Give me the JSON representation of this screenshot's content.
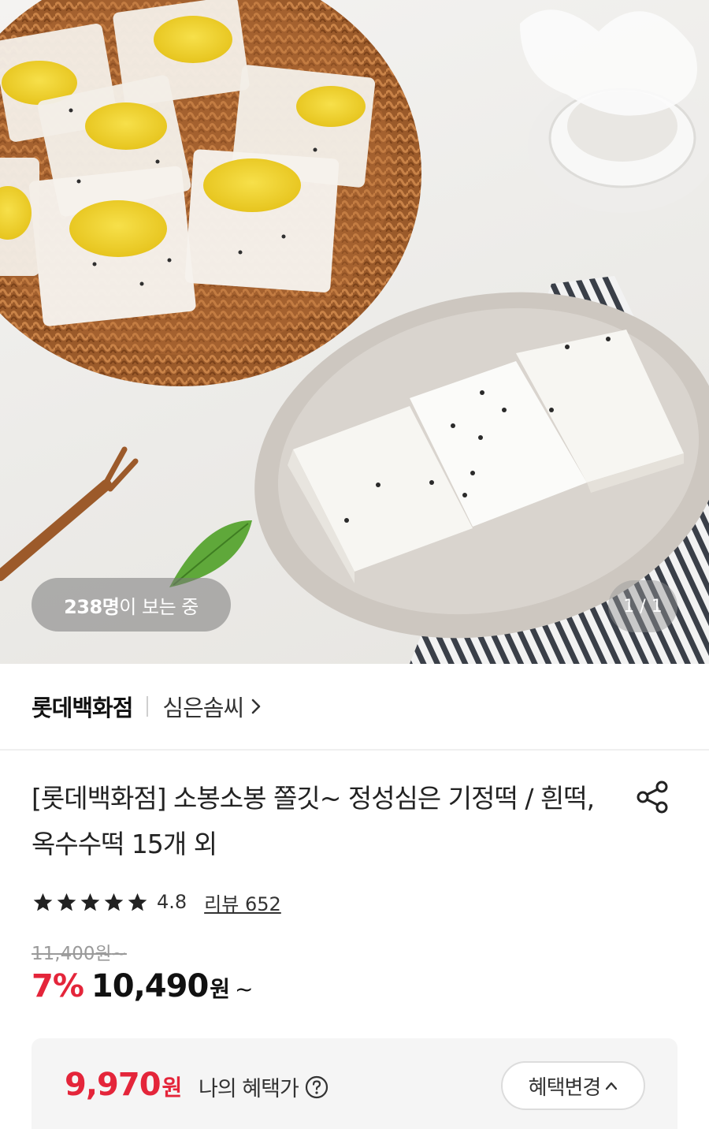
{
  "hero": {
    "viewers_count": "238명",
    "viewers_suffix": "이 보는 중",
    "page_indicator": "1 / 1"
  },
  "seller": {
    "store_name": "롯데백화점",
    "brand_name": "심은솜씨"
  },
  "product": {
    "title": "[롯데백화점] 소봉소봉 쫄깃~ 정성심은 기정떡 / 흰떡, 옥수수떡 15개 외",
    "rating": "4.8",
    "stars": 5,
    "review_label": "리뷰 652"
  },
  "price": {
    "original": "11,400원",
    "original_suffix": "~",
    "discount_rate": "7%",
    "sale_amount": "10,490",
    "sale_unit": "원",
    "sale_suffix": "~"
  },
  "benefit": {
    "amount": "9,970",
    "unit": "원",
    "label": "나의 혜택가",
    "change_button": "혜택변경"
  },
  "colors": {
    "accent_red": "#e4253a",
    "text_dark": "#111111",
    "muted_gray": "#9a9a9a",
    "box_bg": "#f5f5f5"
  }
}
